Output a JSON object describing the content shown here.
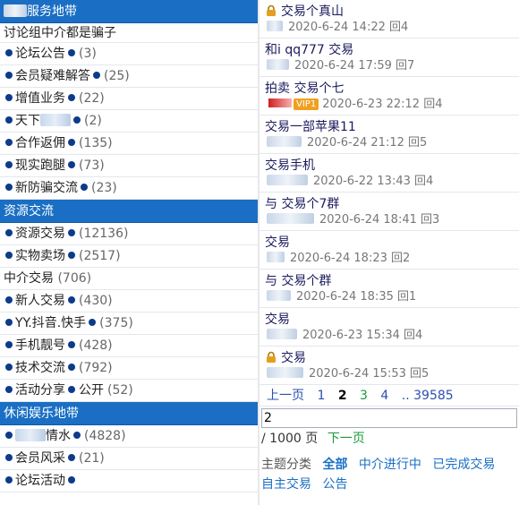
{
  "left": {
    "section1": {
      "title": "服务地带",
      "subtitle": "讨论组中介都是骗子",
      "items": [
        {
          "label": "论坛公告",
          "count": "(3)"
        },
        {
          "label": "会员疑难解答",
          "count": "(25)"
        },
        {
          "label": "增值业务",
          "count": "(22)"
        },
        {
          "label": "天下",
          "count": "(2)"
        },
        {
          "label": "合作返佣",
          "count": "(135)"
        },
        {
          "label": "现实跑腿",
          "count": "(73)"
        },
        {
          "label": "新防骗交流",
          "count": "(23)"
        }
      ]
    },
    "section2": {
      "title": "资源交流",
      "items": [
        {
          "label": "资源交易",
          "count": "(12136)",
          "dot_after": true
        },
        {
          "label": "实物卖场",
          "count": "(2517)",
          "dot_after": true
        },
        {
          "label": "中介交易",
          "count": "(706)",
          "plain": true
        },
        {
          "label": "新人交易",
          "count": "(430)",
          "dot_after": true
        },
        {
          "label": "YY.抖音.快手",
          "count": "(375)",
          "dot_after": true
        },
        {
          "label": "手机靓号",
          "count": "(428)",
          "dot_after": true
        },
        {
          "label": "技术交流",
          "count": "(792)",
          "dot_after": true
        },
        {
          "label": "活动分享",
          "count": "(52)",
          "suffix": "公开"
        }
      ]
    },
    "section3": {
      "title": "休闲娱乐地带",
      "items": [
        {
          "label": "情水",
          "count": "(4828)"
        },
        {
          "label": "会员风采",
          "count": "(21)"
        },
        {
          "label": "论坛活动",
          "count": ""
        }
      ]
    }
  },
  "right": {
    "threads": [
      {
        "title": "交易个真山",
        "meta": "2020-6-24 14:22 回4",
        "locked": true
      },
      {
        "title": "和i        qq777        交易",
        "meta": "2020-6-24 17:59 回7",
        "locked": false
      },
      {
        "title": "拍卖   交易个七",
        "meta": "2020-6-23 22:12 回4",
        "locked": false,
        "vip": "VIP1"
      },
      {
        "title": "交易一部苹果11",
        "meta": "2020-6-24 21:12 回5",
        "locked": false
      },
      {
        "title": "交易手机",
        "meta": "2020-6-22 13:43 回4",
        "locked": false
      },
      {
        "title": "与               交易个7群",
        "meta": "2020-6-24 18:41 回3",
        "locked": false
      },
      {
        "title": "交易",
        "meta": "2020-6-24 18:23 回2",
        "locked": false
      },
      {
        "title": "与               交易个群",
        "meta": "2020-6-24 18:35 回1",
        "locked": false
      },
      {
        "title": "交易",
        "meta": "2020-6-23 15:34 回4",
        "locked": false
      },
      {
        "title": "交易",
        "meta": "2020-6-24 15:53 回5",
        "locked": true
      }
    ],
    "pager": {
      "prev": "上一页",
      "pages": [
        "1",
        "2",
        "3",
        "4"
      ],
      "ellipsis": "..",
      "last": "39585"
    },
    "page_input_value": "2",
    "page_total": "/ 1000 页",
    "next": "下一页",
    "categories": {
      "label": "主题分类",
      "items": [
        "全部",
        "中介进行中",
        "已完成交易",
        "自主交易",
        "公告"
      ]
    }
  },
  "colors": {
    "header": "#1a6fc4",
    "dot": "#0d3b8c",
    "link": "#2a4fb0",
    "green": "#1b9b3a"
  }
}
